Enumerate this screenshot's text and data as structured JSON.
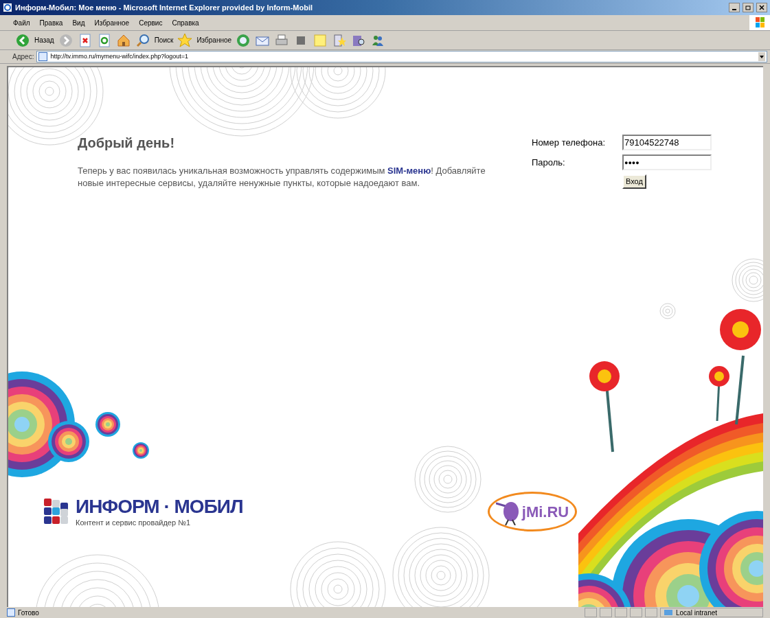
{
  "window": {
    "title": "Информ-Мобил: Мое меню - Microsoft Internet Explorer provided by Inform-Mobil"
  },
  "menu": [
    "Файл",
    "Правка",
    "Вид",
    "Избранное",
    "Сервис",
    "Справка"
  ],
  "toolbar": {
    "back": "Назад",
    "search": "Поиск",
    "favorites": "Избранное"
  },
  "address": {
    "label": "Адрес:",
    "value": "http://tv.immo.ru/mymenu-wifc/index.php?logout=1"
  },
  "page": {
    "heading": "Добрый день!",
    "text_before": "Теперь у вас появилась уникальная возможность управлять содержимым",
    "link": "SIM-меню",
    "text_after": "! Добавляйте новые интересные сервисы, удаляйте ненужные пункты, которые надоедают вам."
  },
  "login": {
    "phone_label": "Номер телефона:",
    "phone_value": "79104522748",
    "password_label": "Пароль:",
    "password_value": "●●●●",
    "submit": "Вход"
  },
  "logo": {
    "name": "ИНФОРМ · МОБИЛ",
    "tagline": "Контент и сервис провайдер №1"
  },
  "badge": {
    "text": "jMi.RU"
  },
  "status_bar": {
    "text": "Готово",
    "zone": "Local intranet"
  }
}
